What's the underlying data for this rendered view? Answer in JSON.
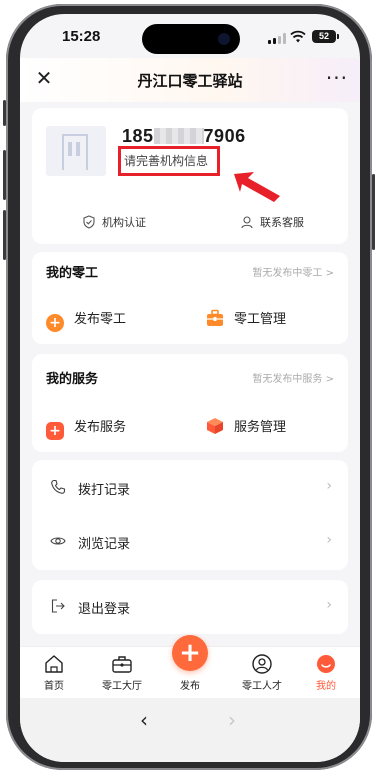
{
  "status_bar": {
    "time": "15:28",
    "battery": "52"
  },
  "header": {
    "title": "丹江口零工驿站",
    "close_icon": "close-icon",
    "more_icon": "more-icon"
  },
  "profile": {
    "phone_prefix": "185",
    "phone_suffix": "7906",
    "org_tip": "请完善机构信息",
    "actions": [
      {
        "label": "机构认证",
        "icon": "shield-check-icon"
      },
      {
        "label": "联系客服",
        "icon": "person-icon"
      }
    ]
  },
  "gig_section": {
    "title": "我的零工",
    "hint": "暂无发布中零工 >",
    "items": [
      {
        "label": "发布零工",
        "icon": "plus-circle-icon",
        "color": "#ff8a2a"
      },
      {
        "label": "零工管理",
        "icon": "toolbox-icon",
        "color": "#ff8a2a"
      }
    ]
  },
  "service_section": {
    "title": "我的服务",
    "hint": "暂无发布中服务 >",
    "items": [
      {
        "label": "发布服务",
        "icon": "plus-square-icon",
        "color": "#ff5a3a"
      },
      {
        "label": "服务管理",
        "icon": "box-icon",
        "color": "#ff5a3a"
      }
    ]
  },
  "records": [
    {
      "label": "拨打记录",
      "icon": "phone-icon"
    },
    {
      "label": "浏览记录",
      "icon": "eye-icon"
    }
  ],
  "logout": {
    "label": "退出登录",
    "icon": "logout-icon"
  },
  "tabbar": {
    "items": [
      {
        "label": "首页",
        "icon": "home-icon"
      },
      {
        "label": "零工大厅",
        "icon": "briefcase-icon"
      },
      {
        "label": "发布",
        "icon": "plus-icon"
      },
      {
        "label": "零工人才",
        "icon": "person-badge-icon"
      },
      {
        "label": "我的",
        "icon": "face-icon",
        "active_color": "#ff5a3a"
      }
    ]
  },
  "browser": {
    "back": "‹",
    "forward": "›"
  },
  "colors": {
    "accent": "#ff6a3d",
    "highlight_box": "#e8202a",
    "arrow": "#e8202a"
  }
}
